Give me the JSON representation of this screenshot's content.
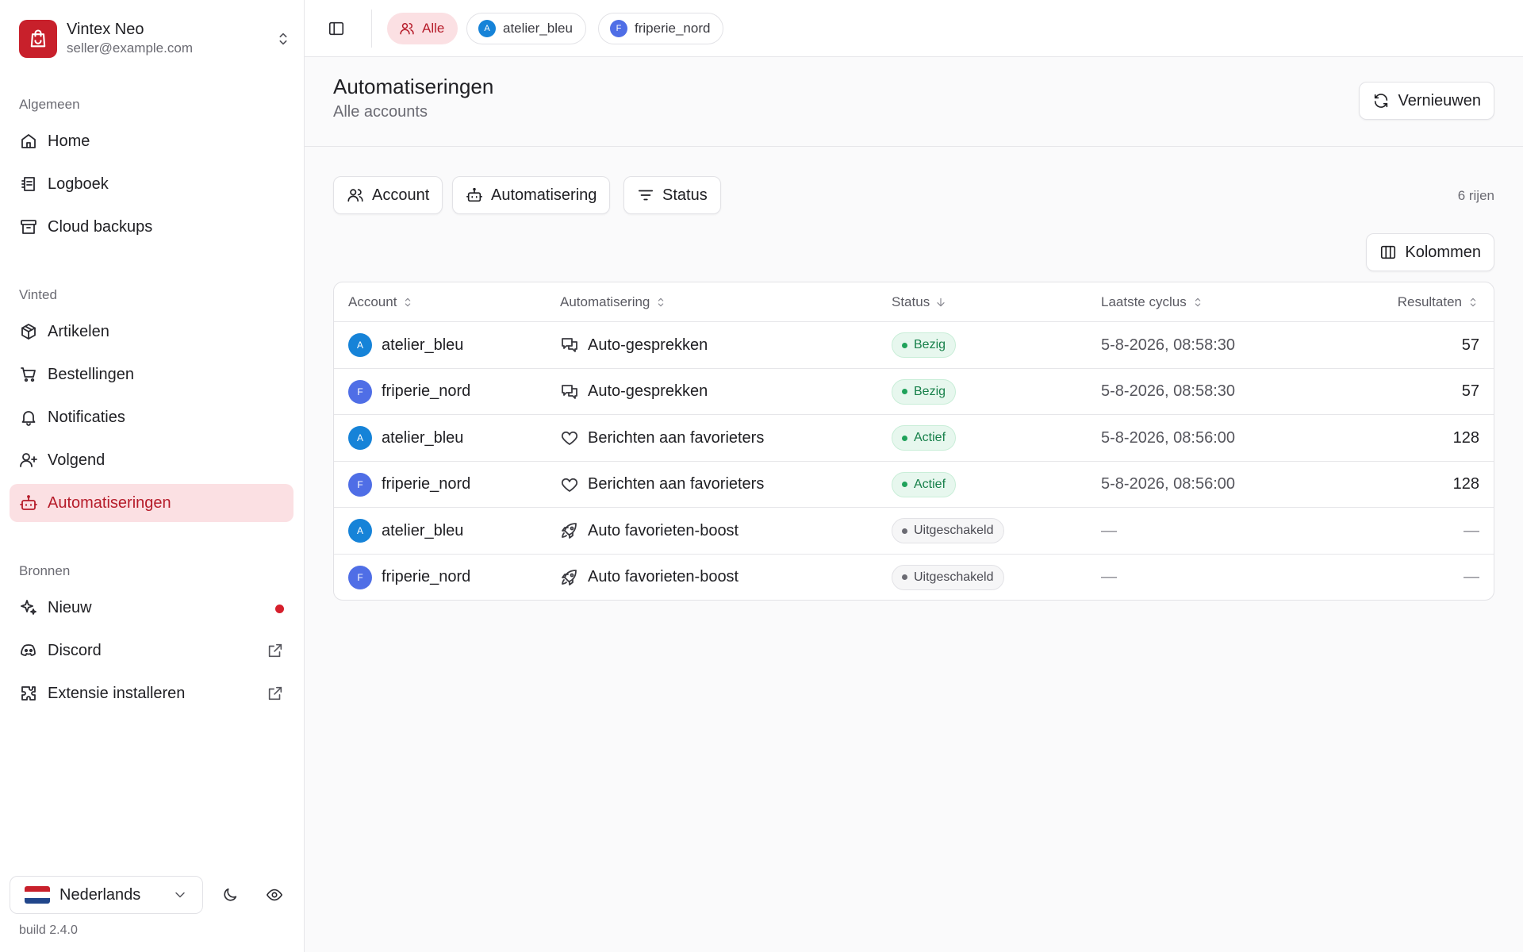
{
  "brand": {
    "name": "Vintex Neo",
    "email": "seller@example.com",
    "color": "#c8202b"
  },
  "sidebar": {
    "sections": [
      {
        "heading": "Algemeen",
        "items": [
          {
            "label": "Home",
            "icon": "home-icon"
          },
          {
            "label": "Logboek",
            "icon": "logbook-icon"
          },
          {
            "label": "Cloud backups",
            "icon": "archive-icon"
          }
        ]
      },
      {
        "heading": "Vinted",
        "items": [
          {
            "label": "Artikelen",
            "icon": "package-icon"
          },
          {
            "label": "Bestellingen",
            "icon": "cart-icon"
          },
          {
            "label": "Notificaties",
            "icon": "bell-icon"
          },
          {
            "label": "Volgend",
            "icon": "user-plus-icon"
          },
          {
            "label": "Automatiseringen",
            "icon": "bot-icon",
            "active": true
          }
        ]
      },
      {
        "heading": "Bronnen",
        "items": [
          {
            "label": "Nieuw",
            "icon": "sparkles-icon",
            "indicator": true
          },
          {
            "label": "Discord",
            "icon": "discord-icon",
            "external": true
          },
          {
            "label": "Extensie installeren",
            "icon": "puzzle-icon",
            "external": true
          }
        ]
      }
    ],
    "language": "Nederlands",
    "build": "build 2.4.0"
  },
  "topbar": {
    "chips": [
      {
        "label": "Alle",
        "active": true
      },
      {
        "label": "atelier_bleu",
        "avatar": "A",
        "avatar_color": "#1683d8"
      },
      {
        "label": "friperie_nord",
        "avatar": "F",
        "avatar_color": "#4f6ee6"
      }
    ]
  },
  "header": {
    "title": "Automatiseringen",
    "subtitle": "Alle accounts",
    "refresh_label": "Vernieuwen"
  },
  "filters": {
    "account_label": "Account",
    "automation_label": "Automatisering",
    "status_label": "Status",
    "row_count": "6 rijen",
    "columns_label": "Kolommen"
  },
  "table": {
    "columns": [
      "Account",
      "Automatisering",
      "Status",
      "Laatste cyclus",
      "Resultaten"
    ],
    "rows": [
      {
        "account": "atelier_bleu",
        "avatar": "A",
        "avatar_color": "#1683d8",
        "automation": "Auto-gesprekken",
        "automation_icon": "chat-icon",
        "status": "Bezig",
        "status_tone": "green",
        "last_cycle": "5-8-2026, 08:58:30",
        "results": "57"
      },
      {
        "account": "friperie_nord",
        "avatar": "F",
        "avatar_color": "#4f6ee6",
        "automation": "Auto-gesprekken",
        "automation_icon": "chat-icon",
        "status": "Bezig",
        "status_tone": "green",
        "last_cycle": "5-8-2026, 08:58:30",
        "results": "57"
      },
      {
        "account": "atelier_bleu",
        "avatar": "A",
        "avatar_color": "#1683d8",
        "automation": "Berichten aan favorieters",
        "automation_icon": "heart-icon",
        "status": "Actief",
        "status_tone": "green",
        "last_cycle": "5-8-2026, 08:56:00",
        "results": "128"
      },
      {
        "account": "friperie_nord",
        "avatar": "F",
        "avatar_color": "#4f6ee6",
        "automation": "Berichten aan favorieters",
        "automation_icon": "heart-icon",
        "status": "Actief",
        "status_tone": "green",
        "last_cycle": "5-8-2026, 08:56:00",
        "results": "128"
      },
      {
        "account": "atelier_bleu",
        "avatar": "A",
        "avatar_color": "#1683d8",
        "automation": "Auto favorieten-boost",
        "automation_icon": "rocket-icon",
        "status": "Uitgeschakeld",
        "status_tone": "gray",
        "last_cycle": "—",
        "results": "—"
      },
      {
        "account": "friperie_nord",
        "avatar": "F",
        "avatar_color": "#4f6ee6",
        "automation": "Auto favorieten-boost",
        "automation_icon": "rocket-icon",
        "status": "Uitgeschakeld",
        "status_tone": "gray",
        "last_cycle": "—",
        "results": "—"
      }
    ]
  }
}
